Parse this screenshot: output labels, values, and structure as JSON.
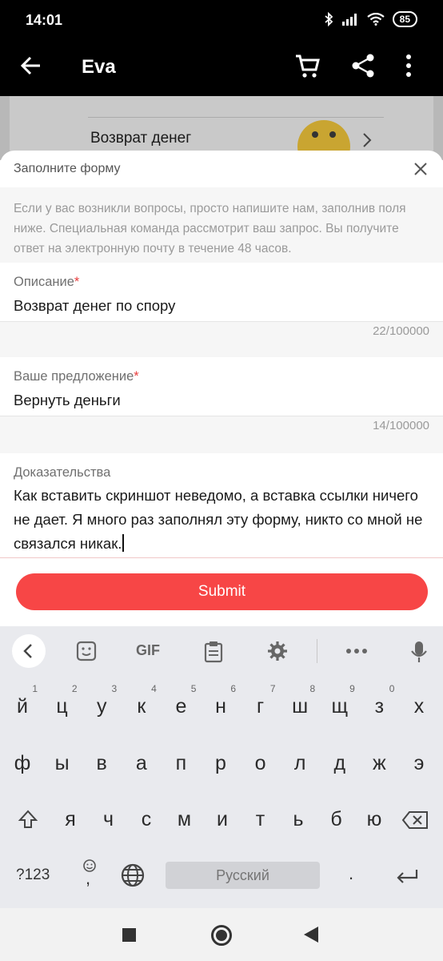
{
  "status_bar": {
    "time": "14:01",
    "battery": "85"
  },
  "app_bar": {
    "title": "Eva"
  },
  "background": {
    "row_label": "Возврат денег"
  },
  "sheet": {
    "title": "Заполните форму",
    "description": "Если у вас возникли вопросы, просто напишите нам, заполнив поля ниже. Специальная команда рассмотрит ваш запрос. Вы получите ответ на электронную почту в течение 48 часов.",
    "fields": [
      {
        "label": "Описание",
        "required": "*",
        "value": "Возврат денег по спору",
        "counter": "22/100000"
      },
      {
        "label": "Ваше предложение",
        "required": "*",
        "value": "Вернуть деньги",
        "counter": "14/100000"
      },
      {
        "label": "Доказательства",
        "value": "Как вставить скриншот неведомо, а вставка ссылки ничего не дает. Я много раз заполнял эту форму, никто со мной не связался никак."
      }
    ],
    "submit_label": "Submit"
  },
  "keyboard": {
    "toolbar": [
      "back",
      "sticker",
      "GIF",
      "clipboard",
      "settings",
      "more",
      "mic"
    ],
    "gif_label": "GIF",
    "row1": [
      "й",
      "ц",
      "у",
      "к",
      "е",
      "н",
      "г",
      "ш",
      "щ",
      "з",
      "х"
    ],
    "row1_hints": [
      "1",
      "2",
      "3",
      "4",
      "5",
      "6",
      "7",
      "8",
      "9",
      "0",
      ""
    ],
    "row2": [
      "ф",
      "ы",
      "в",
      "а",
      "п",
      "р",
      "о",
      "л",
      "д",
      "ж",
      "э"
    ],
    "row3": [
      "я",
      "ч",
      "с",
      "м",
      "и",
      "т",
      "ь",
      "б",
      "ю"
    ],
    "symbols_label": "?123",
    "comma": ",",
    "space_label": "Русский",
    "period": "."
  },
  "colors": {
    "accent": "#f74646",
    "required": "#e83e3e"
  }
}
